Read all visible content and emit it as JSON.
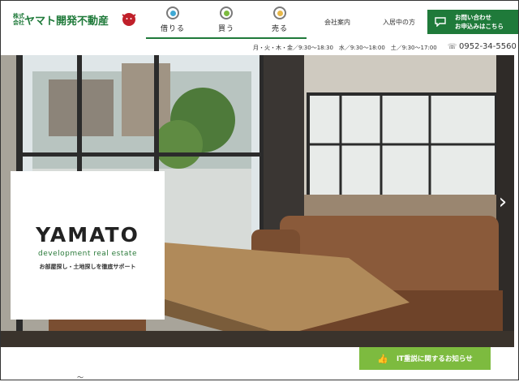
{
  "header": {
    "logo_small": "株式会社",
    "logo_main": "ヤマト開発不動産",
    "nav": [
      {
        "label": "借りる",
        "color": "#3fa9d4"
      },
      {
        "label": "買う",
        "color": "#7dbb3f"
      },
      {
        "label": "売る",
        "color": "#e8b84a"
      }
    ],
    "links": [
      "会社案内",
      "入居中の方"
    ],
    "contact_line1": "お問い合わせ",
    "contact_line2": "お申込みはこちら",
    "brand_color": "#1f7a3a"
  },
  "infobar": {
    "hours": "月・火・木・金／9:30～18:30　水／9:30～18:00　土／9:30～17:00",
    "phone": "0952-34-5560"
  },
  "hero": {
    "brand_title": "YAMATO",
    "brand_sub": "development real estate",
    "brand_tag": "お部屋探し・土地探しを徹底サポート",
    "prev_arrow": "‹",
    "next_arrow": "›"
  },
  "news_button": "IT重説に関するお知らせ",
  "partial": "～"
}
